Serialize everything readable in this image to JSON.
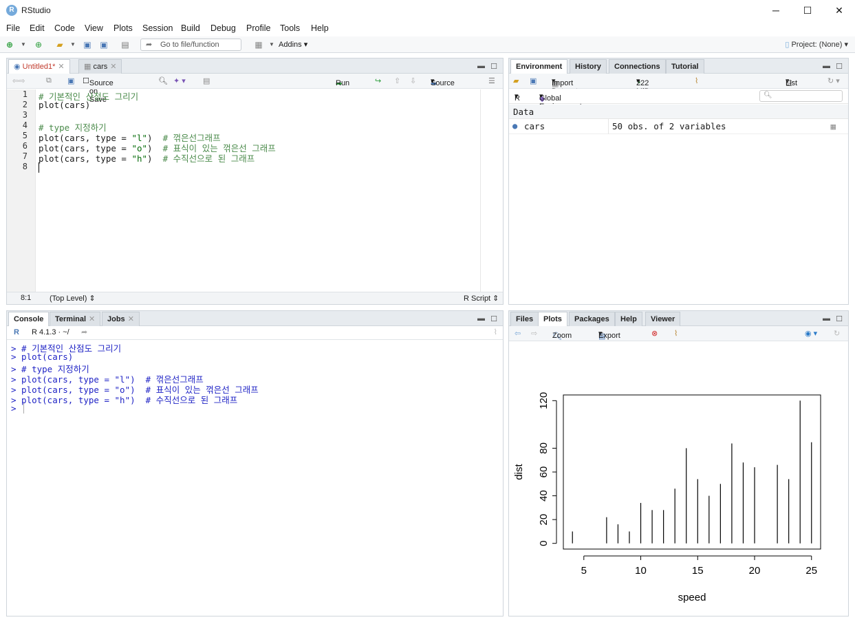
{
  "window": {
    "title": "RStudio",
    "app_icon": "R",
    "minimize": "─",
    "maximize": "☐",
    "close": "✕"
  },
  "menu": [
    "File",
    "Edit",
    "Code",
    "View",
    "Plots",
    "Session",
    "Build",
    "Debug",
    "Profile",
    "Tools",
    "Help"
  ],
  "toolbar": {
    "goto_placeholder": "Go to file/function",
    "addins": "Addins",
    "project": "Project: (None)"
  },
  "editor": {
    "tabs": [
      {
        "label": "Untitled1*",
        "active": true
      },
      {
        "label": "cars",
        "active": false
      }
    ],
    "source_on_save": "Source on Save",
    "run": "Run",
    "source": "Source",
    "line_numbers": [
      "1",
      "2",
      "3",
      "4",
      "5",
      "6",
      "7",
      "8"
    ],
    "lines": [
      [
        {
          "t": "# 기본적인 산점도 그리기",
          "c": "cmt"
        }
      ],
      [
        {
          "t": "plot(cars)",
          "c": ""
        }
      ],
      [
        {
          "t": "",
          "c": ""
        }
      ],
      [
        {
          "t": "# type 지정하기",
          "c": "cmt"
        }
      ],
      [
        {
          "t": "plot(cars, type = ",
          "c": ""
        },
        {
          "t": "\"l\"",
          "c": "str"
        },
        {
          "t": ")  ",
          "c": ""
        },
        {
          "t": "# 꺾은선그래프",
          "c": "cmt"
        }
      ],
      [
        {
          "t": "plot(cars, type = ",
          "c": ""
        },
        {
          "t": "\"o\"",
          "c": "str"
        },
        {
          "t": ")  ",
          "c": ""
        },
        {
          "t": "# 표식이 있는 꺾은선 그래프",
          "c": "cmt"
        }
      ],
      [
        {
          "t": "plot(cars, type = ",
          "c": ""
        },
        {
          "t": "\"h\"",
          "c": "str"
        },
        {
          "t": ")  ",
          "c": ""
        },
        {
          "t": "# 수직선으로 된 그래프",
          "c": "cmt"
        }
      ],
      [
        {
          "t": "",
          "c": ""
        }
      ]
    ],
    "status_pos": "8:1",
    "status_scope": "(Top Level) ⇕",
    "status_type": "R Script ⇕"
  },
  "console": {
    "tabs": [
      {
        "label": "Console"
      },
      {
        "label": "Terminal"
      },
      {
        "label": "Jobs"
      }
    ],
    "version": "R 4.1.3 · ~/",
    "lines": [
      "> # 기본적인 산점도 그리기",
      "> plot(cars)",
      "> # type 지정하기",
      "> plot(cars, type = \"l\")  # 꺾은선그래프",
      "> plot(cars, type = \"o\")  # 표식이 있는 꺾은선 그래프",
      "> plot(cars, type = \"h\")  # 수직선으로 된 그래프",
      "> "
    ]
  },
  "environment": {
    "tabs": [
      {
        "label": "Environment"
      },
      {
        "label": "History"
      },
      {
        "label": "Connections"
      },
      {
        "label": "Tutorial"
      }
    ],
    "import_dataset": "Import Dataset",
    "memory": "222 MiB",
    "list_view": "List",
    "lang": "R",
    "scope": "Global Environment",
    "section": "Data",
    "rows": [
      {
        "name": "cars",
        "value": "50 obs. of 2 variables"
      }
    ]
  },
  "files_pane": {
    "tabs": [
      {
        "label": "Files"
      },
      {
        "label": "Plots"
      },
      {
        "label": "Packages"
      },
      {
        "label": "Help"
      },
      {
        "label": "Viewer"
      }
    ],
    "zoom": "Zoom",
    "export": "Export"
  },
  "chart_data": {
    "type": "bar",
    "style": "vertical lines (type = h)",
    "xlabel": "speed",
    "ylabel": "dist",
    "xlim": [
      3.2,
      25.8
    ],
    "ylim": [
      -4.8,
      124.8
    ],
    "xticks": [
      5,
      10,
      15,
      20,
      25
    ],
    "yticks": [
      0,
      20,
      40,
      60,
      80,
      120
    ],
    "x": [
      4,
      7,
      8,
      9,
      10,
      11,
      12,
      13,
      14,
      15,
      16,
      17,
      18,
      19,
      20,
      22,
      23,
      24,
      25
    ],
    "y": [
      10,
      22,
      16,
      10,
      34,
      28,
      28,
      46,
      80,
      54,
      40,
      50,
      84,
      68,
      64,
      66,
      54,
      120,
      85
    ]
  }
}
